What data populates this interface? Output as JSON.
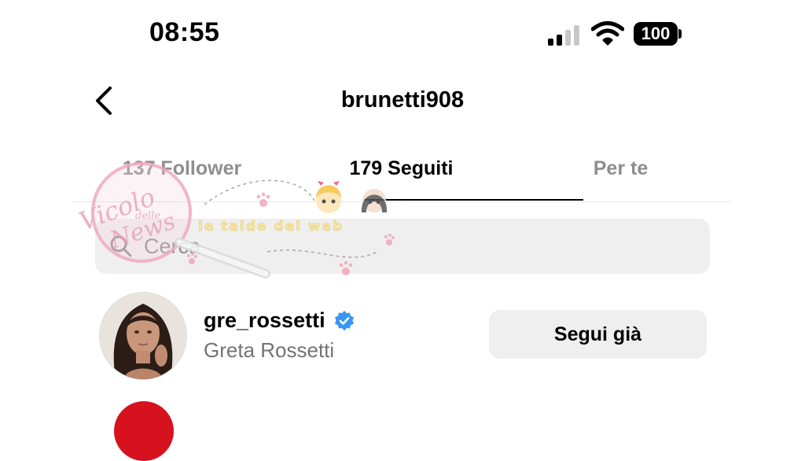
{
  "status_bar": {
    "time": "08:55",
    "battery": "100"
  },
  "nav": {
    "title": "brunetti908"
  },
  "tabs": [
    {
      "label": "137 Follower",
      "active": false
    },
    {
      "label": "179 Seguiti",
      "active": true
    },
    {
      "label": "Per te",
      "active": false
    }
  ],
  "search": {
    "placeholder": "Cerca",
    "value": ""
  },
  "users": [
    {
      "username": "gre_rossetti",
      "full_name": "Greta Rossetti",
      "verified": true,
      "button": "Segui già"
    }
  ],
  "watermark": {
    "text_1": "Vicolo",
    "text_2": "delle",
    "text_3": "News",
    "text_4": "le taide del web"
  },
  "colors": {
    "accent_verified": "#3897f0",
    "muted_text": "#737373",
    "button_bg": "#efefef"
  }
}
